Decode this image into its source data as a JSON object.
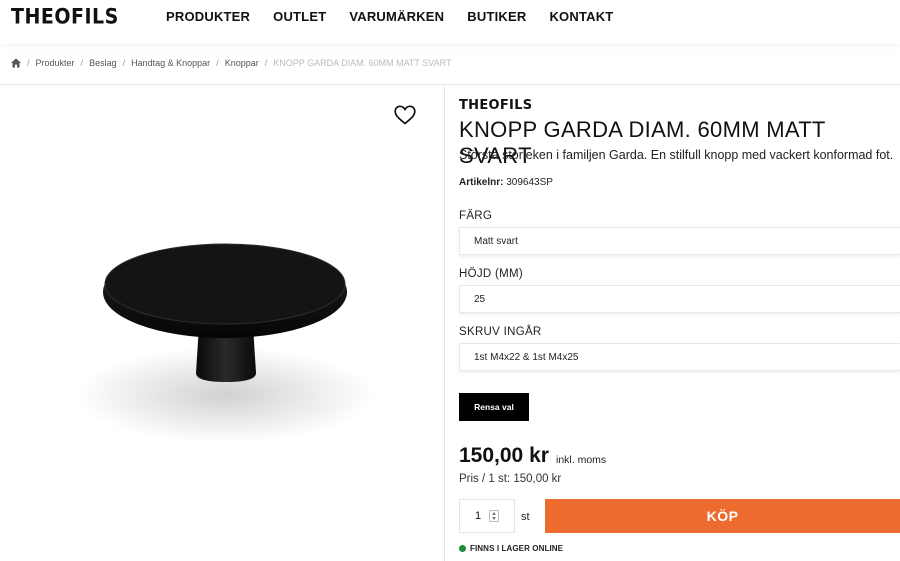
{
  "header": {
    "logo": "THEOFILS",
    "nav": [
      "PRODUKTER",
      "OUTLET",
      "VARUMÄRKEN",
      "BUTIKER",
      "KONTAKT"
    ]
  },
  "breadcrumb": {
    "items": [
      "Produkter",
      "Beslag",
      "Handtag & Knoppar",
      "Knoppar"
    ],
    "current": "KNOPP GARDA DIAM. 60MM MATT SVART"
  },
  "product": {
    "brand": "THEOFILS",
    "title": "KNOPP GARDA DIAM. 60MM MATT SVART",
    "description": "Största storleken i familjen Garda. En stilfull knopp med vackert konformad fot.",
    "article_label": "Artikelnr:",
    "article_value": " 309643SP",
    "options": [
      {
        "label": "FÄRG",
        "value": "Matt svart"
      },
      {
        "label": "HÖJD (MM)",
        "value": "25"
      },
      {
        "label": "SKRUV INGÅR",
        "value": "1st M4x22 & 1st M4x25"
      }
    ],
    "clear_label": "Rensa val",
    "price": "150,00 kr",
    "price_note": "inkl. moms",
    "unit_price": "Pris / 1 st: 150,00 kr",
    "quantity": "1",
    "quantity_unit": "st",
    "buy_label": "KÖP",
    "stock_status": "FINNS I LAGER ONLINE"
  },
  "colors": {
    "accent": "#ee6b2f",
    "in_stock": "#1e8a3a"
  },
  "icons": [
    "home-icon",
    "heart-icon",
    "stepper-icon"
  ]
}
